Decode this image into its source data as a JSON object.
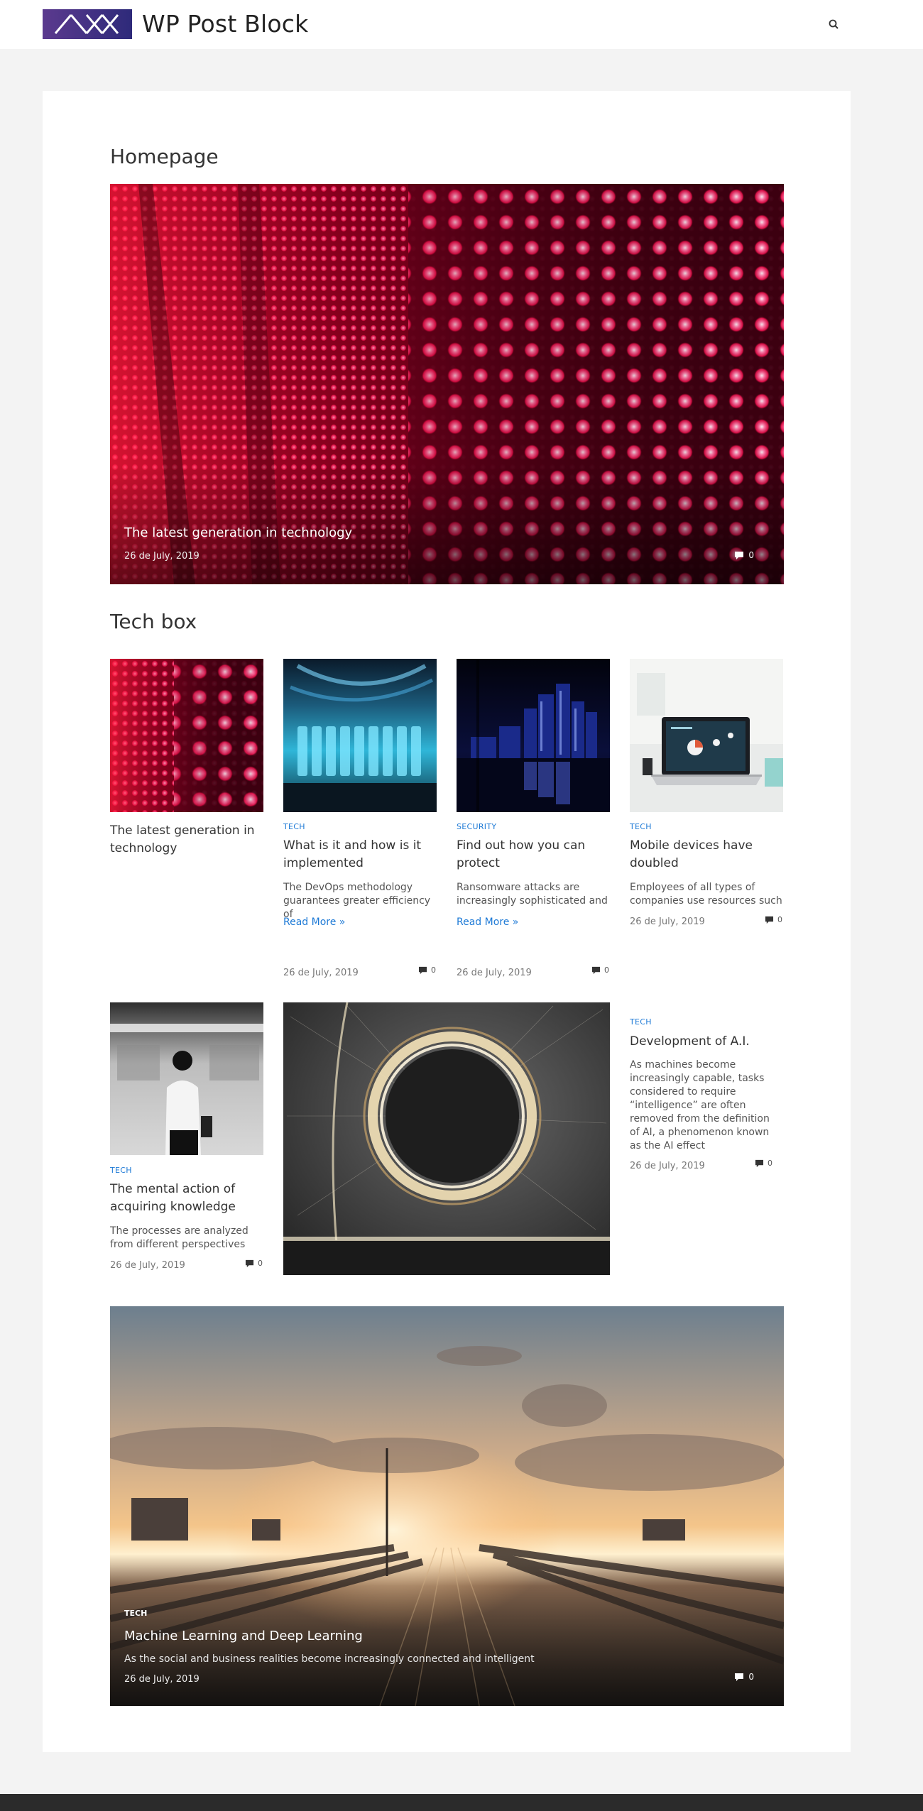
{
  "header": {
    "site_title": "WP Post Block"
  },
  "sections": {
    "homepage_title": "Homepage",
    "techbox_title": "Tech box"
  },
  "hero": {
    "title": "The latest generation in technology",
    "date": "26 de July, 2019",
    "comments": "0"
  },
  "cards": [
    {
      "title_line1": "The latest generation in",
      "title_line2": "technology"
    },
    {
      "category": "TECH",
      "title_line1": "What is it and how is it",
      "title_line2": "implemented",
      "excerpt_line1": "The DevOps methodology",
      "excerpt_line2": "guarantees greater efficiency of",
      "read_more": "Read More »",
      "date": "26 de July, 2019",
      "comments": "0"
    },
    {
      "category": "SECURITY",
      "title_line1": "Find out how you can",
      "title_line2": "protect",
      "excerpt_line1": "Ransomware attacks are",
      "excerpt_line2": "increasingly sophisticated and",
      "read_more": "Read More »",
      "date": "26 de July, 2019",
      "comments": "0"
    },
    {
      "category": "TECH",
      "title_line1": "Mobile devices have",
      "title_line2": "doubled",
      "excerpt_line1": "Employees of all types of",
      "excerpt_line2": "companies use resources such",
      "date": "26 de July, 2019",
      "comments": "0"
    },
    {
      "category": "TECH",
      "title_line1": "The mental action of",
      "title_line2": "acquiring knowledge",
      "excerpt_line1": "The processes are analyzed",
      "excerpt_line2": "from different perspectives",
      "date": "26 de July, 2019",
      "comments": "0"
    },
    {
      "category": "TECH",
      "title_line1": "Development of A.I.",
      "excerpt_lines": [
        "As machines become",
        "increasingly capable, tasks",
        "considered to require",
        "“intelligence” are often",
        "removed from the definition",
        "of AI, a phenomenon known",
        "as the AI effect"
      ],
      "date": "26 de July, 2019",
      "comments": "0"
    }
  ],
  "featured": {
    "category": "TECH",
    "title": "Machine Learning and Deep Learning",
    "excerpt": "As the social and business realities become increasingly connected and intelligent",
    "date": "26 de July, 2019",
    "comments": "0"
  },
  "colors": {
    "accent_link": "#1e7ad6",
    "logo_purple": "#4a2f86",
    "footer": "#2b2b2b"
  },
  "icons": {
    "search": "search-icon",
    "comment": "comment-icon"
  }
}
